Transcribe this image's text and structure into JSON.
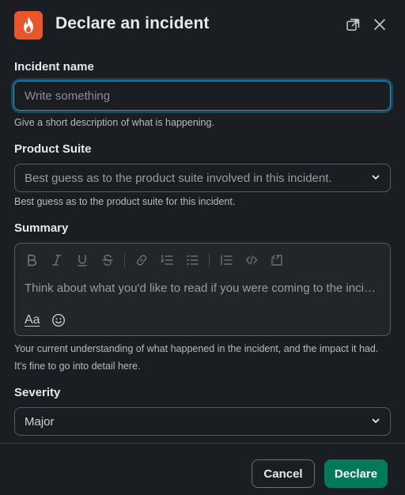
{
  "header": {
    "title": "Declare an incident",
    "app_icon": "flame-icon",
    "popout_icon": "popout-icon",
    "close_icon": "close-icon",
    "accent_color": "#e8562c"
  },
  "form": {
    "incident_name": {
      "label": "Incident name",
      "placeholder": "Write something",
      "value": "",
      "hint": "Give a short description of what is happening."
    },
    "product_suite": {
      "label": "Product Suite",
      "placeholder": "Best guess as to the product suite involved in this incident.",
      "hint": "Best guess as to the product suite for this incident."
    },
    "summary": {
      "label": "Summary",
      "placeholder": "Think about what you'd like to read if you were coming to the incident fresh.",
      "hint": "Your current understanding of what happened in the incident, and the impact it had. It's fine to go into detail here.",
      "format_label": "Aa",
      "toolbar_icons": [
        "bold-icon",
        "italic-icon",
        "underline-icon",
        "strikethrough-icon",
        "link-icon",
        "ordered-list-icon",
        "bulleted-list-icon",
        "blockquote-icon",
        "code-icon",
        "code-block-icon"
      ]
    },
    "severity": {
      "label": "Severity",
      "selected": "Major"
    }
  },
  "footer": {
    "cancel_label": "Cancel",
    "declare_label": "Declare",
    "declare_color": "#007a5a"
  }
}
